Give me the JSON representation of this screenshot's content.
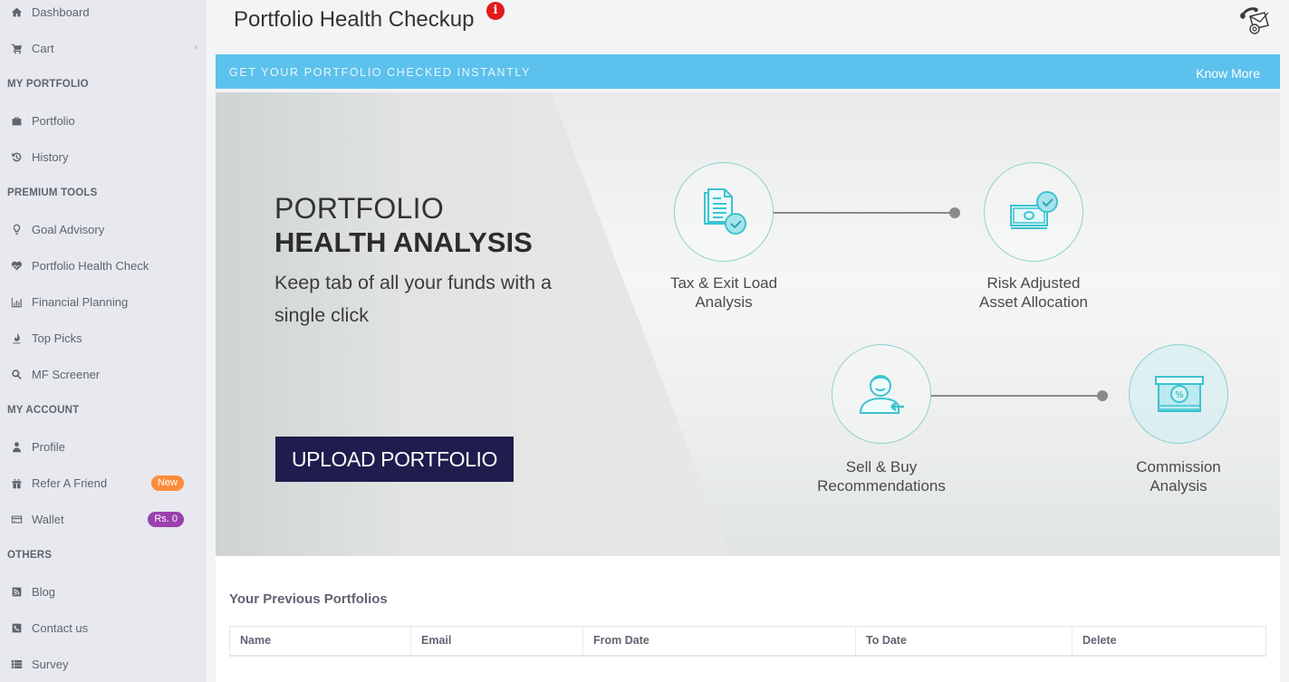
{
  "sidebar": {
    "items": [
      {
        "label": "Dashboard",
        "icon": "home-icon"
      },
      {
        "label": "Cart",
        "icon": "cart-icon",
        "chevron": "›"
      }
    ],
    "sections": [
      {
        "heading": "MY PORTFOLIO",
        "items": [
          {
            "label": "Portfolio",
            "icon": "briefcase-icon"
          },
          {
            "label": "History",
            "icon": "history-icon"
          }
        ]
      },
      {
        "heading": "PREMIUM TOOLS",
        "items": [
          {
            "label": "Goal Advisory",
            "icon": "lightbulb-icon"
          },
          {
            "label": "Portfolio Health Check",
            "icon": "heartbeat-icon"
          },
          {
            "label": "Financial Planning",
            "icon": "bar-chart-icon"
          },
          {
            "label": "Top Picks",
            "icon": "flame-icon"
          },
          {
            "label": "MF Screener",
            "icon": "search-icon"
          }
        ]
      },
      {
        "heading": "MY ACCOUNT",
        "items": [
          {
            "label": "Profile",
            "icon": "user-icon"
          },
          {
            "label": "Refer A Friend",
            "icon": "gift-icon",
            "badge": "New",
            "badge_color": "#fb8c3c"
          },
          {
            "label": "Wallet",
            "icon": "credit-card-icon",
            "badge": "Rs. 0",
            "badge_color": "#9b3fae"
          }
        ]
      },
      {
        "heading": "OTHERS",
        "items": [
          {
            "label": "Blog",
            "icon": "rss-icon"
          },
          {
            "label": "Contact us",
            "icon": "phone-icon"
          },
          {
            "label": "Survey",
            "icon": "list-icon"
          }
        ]
      }
    ]
  },
  "header": {
    "title": "Portfolio Health Checkup",
    "info_icon_glyph": "i",
    "contact_icon": "phone-mail-icon"
  },
  "strip": {
    "text": "GET YOUR PORTFOLIO CHECKED INSTANTLY",
    "link": "Know More",
    "color": "#5cc1ec"
  },
  "banner": {
    "title_line1": "PORTFOLIO",
    "title_line2": "HEALTH ANALYSIS",
    "subtitle": "Keep tab of all your funds with a single click",
    "upload_button": "UPLOAD PORTFOLIO",
    "button_color": "#1f1c4e",
    "features": [
      {
        "label_line1": "Tax & Exit Load",
        "label_line2": "Analysis",
        "icon": "document-check-icon"
      },
      {
        "label_line1": "Risk Adjusted",
        "label_line2": "Asset Allocation",
        "icon": "money-check-icon"
      },
      {
        "label_line1": "Sell & Buy",
        "label_line2": "Recommendations",
        "icon": "advisor-icon"
      },
      {
        "label_line1": "Commission",
        "label_line2": "Analysis",
        "icon": "commission-icon"
      }
    ],
    "accent": "#3cc3d0"
  },
  "previous": {
    "title": "Your Previous Portfolios",
    "columns": [
      "Name",
      "Email",
      "From Date",
      "To Date",
      "Delete"
    ],
    "rows": []
  }
}
